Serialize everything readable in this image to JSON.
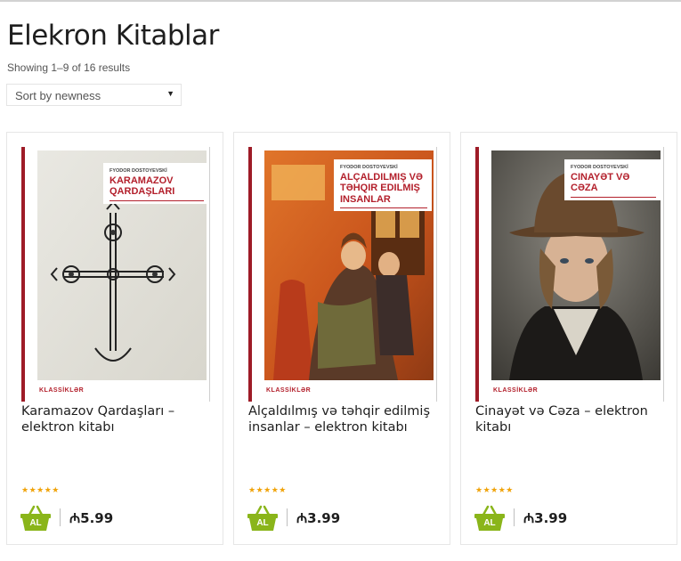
{
  "page": {
    "title": "Elekron Kitablar",
    "result_count": "Showing 1–9 of 16 results",
    "sort": {
      "selected": "Sort by newness"
    }
  },
  "colors": {
    "brand_red": "#b3202c",
    "cart_green": "#8ab51a",
    "star": "#f0a30a"
  },
  "products": [
    {
      "name": "Karamazov Qardaşları – elektron kitabı",
      "cover_author": "FYODOR DOSTOYEVSKİ",
      "cover_title": "Karamazov Qardaşları",
      "cover_series": "KLASSİKLƏR",
      "rating_stars": "★★★★★",
      "cart_label": "AL",
      "currency_symbol": "₼",
      "price": "5.99"
    },
    {
      "name": "Alçaldılmış və təhqir edilmiş insanlar – elektron kitabı",
      "cover_author": "FYODOR DOSTOYEVSKİ",
      "cover_title": "Alçaldılmış və təhqir edilmiş insanlar",
      "cover_series": "KLASSİKLƏR",
      "rating_stars": "★★★★★",
      "cart_label": "AL",
      "currency_symbol": "₼",
      "price": "3.99"
    },
    {
      "name": "Cinayət və Cəza – elektron kitabı",
      "cover_author": "FYODOR DOSTOYEVSKİ",
      "cover_title": "Cinayət və Cəza",
      "cover_series": "KLASSİKLƏR",
      "rating_stars": "★★★★★",
      "cart_label": "AL",
      "currency_symbol": "₼",
      "price": "3.99"
    }
  ]
}
